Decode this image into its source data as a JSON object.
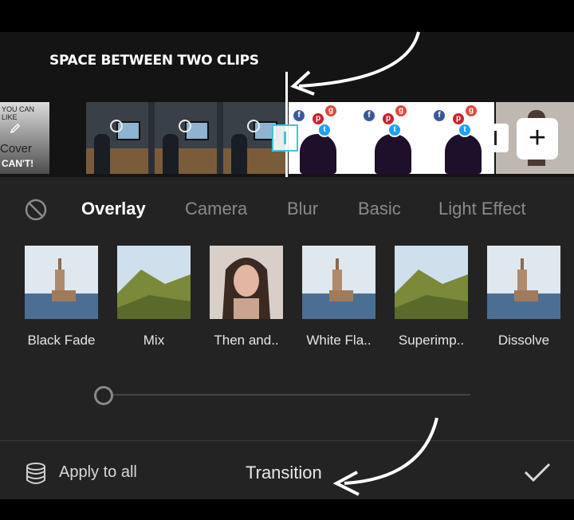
{
  "annotation": {
    "top_label": "SPACE BETWEEN TWO CLIPS"
  },
  "timeline": {
    "cover_clip": {
      "top_text": "YOU CAN LIKE",
      "label": "Cover",
      "sub_text": "CAN'T!"
    },
    "add_button": "+"
  },
  "tabs": [
    {
      "label": "Overlay",
      "active": true
    },
    {
      "label": "Camera",
      "active": false
    },
    {
      "label": "Blur",
      "active": false
    },
    {
      "label": "Basic",
      "active": false
    },
    {
      "label": "Light Effect",
      "active": false
    }
  ],
  "transitions": [
    {
      "label": "Black Fade",
      "thumb": "tower"
    },
    {
      "label": "Mix",
      "thumb": "hills"
    },
    {
      "label": "Then and..",
      "thumb": "portrait"
    },
    {
      "label": "White Fla..",
      "thumb": "tower"
    },
    {
      "label": "Superimp..",
      "thumb": "hills"
    },
    {
      "label": "Dissolve",
      "thumb": "tower"
    }
  ],
  "slider": {
    "value": 0
  },
  "footer": {
    "apply_all": "Apply to all",
    "title": "Transition"
  },
  "colors": {
    "panel": "#232323",
    "accent_cyan": "#3ec6d8",
    "active_tab": "#ffffff",
    "inactive_tab": "#8a8a8a"
  }
}
